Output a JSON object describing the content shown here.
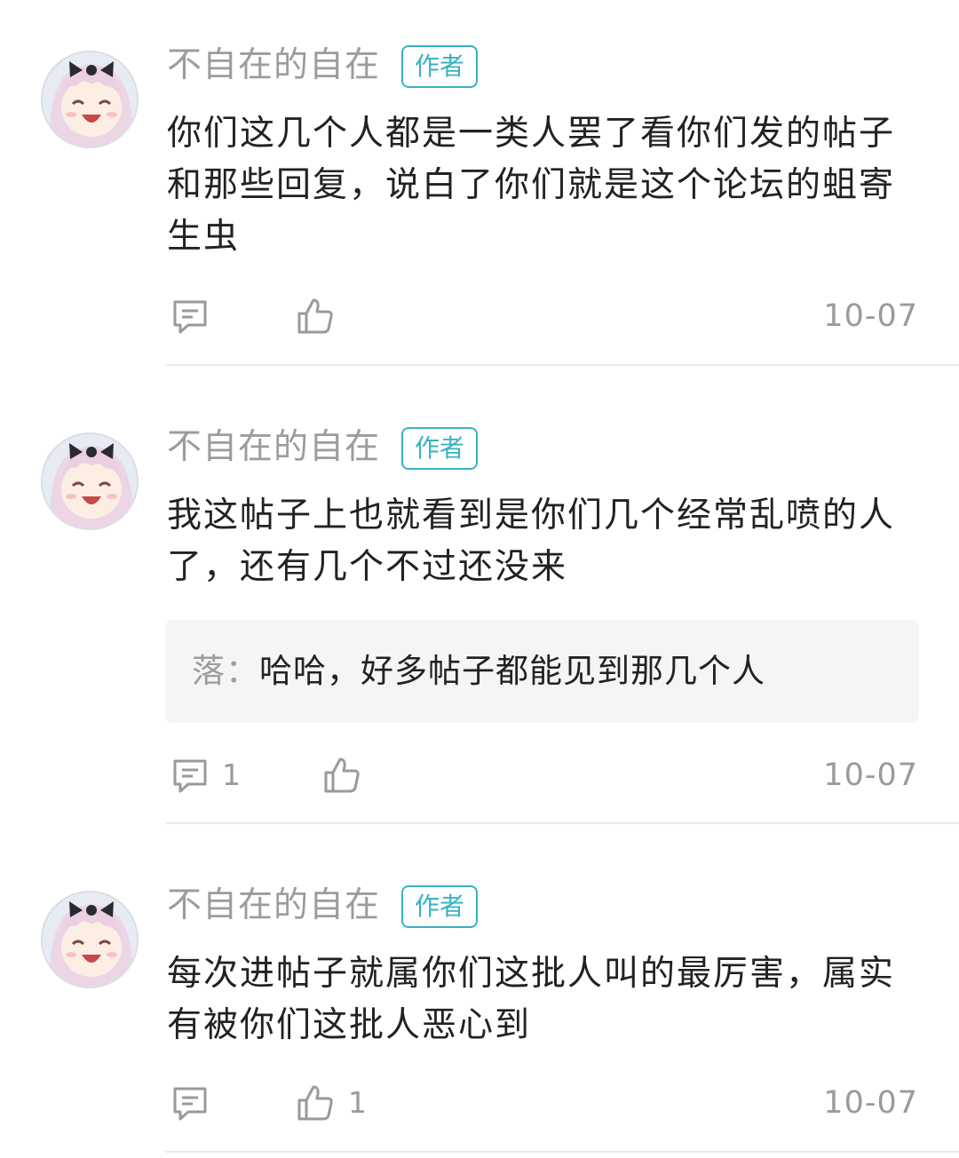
{
  "comments": [
    {
      "username": "不自在的自在",
      "badge": "作者",
      "text": "你们这几个人都是一类人罢了看你们发的帖子和那些回复，说白了你们就是这个论坛的蛆寄生虫",
      "reply_count": "",
      "like_count": "",
      "date": "10-07"
    },
    {
      "username": "不自在的自在",
      "badge": "作者",
      "text": "我这帖子上也就看到是你们几个经常乱喷的人了，还有几个不过还没来",
      "reply": {
        "author": "落：",
        "text": "哈哈，好多帖子都能见到那几个人"
      },
      "reply_count": "1",
      "like_count": "",
      "date": "10-07"
    },
    {
      "username": "不自在的自在",
      "badge": "作者",
      "text": "每次进帖子就属你们这批人叫的最厉害，属实有被你们这批人恶心到",
      "reply_count": "",
      "like_count": "1",
      "date": "10-07"
    }
  ],
  "icons": {
    "comment": "comment-icon",
    "like": "thumbs-up-icon",
    "avatar": "anime-girl-avatar"
  },
  "colors": {
    "accent": "#37b2c2",
    "muted": "#9c9c9c",
    "text": "#222222",
    "reply_bg": "#f5f5f5"
  }
}
